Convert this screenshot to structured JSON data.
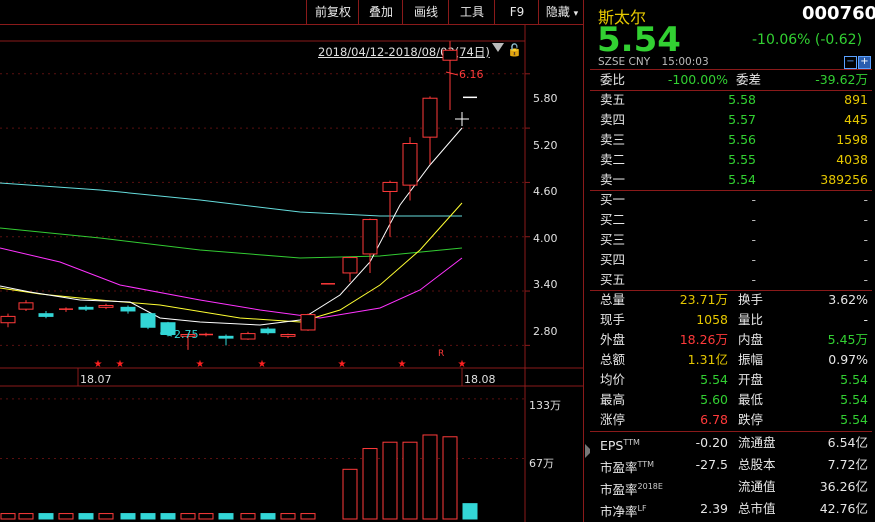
{
  "toolbar": {
    "buttons": [
      "前复权",
      "叠加",
      "画线",
      "工具",
      "F9",
      "隐藏"
    ]
  },
  "chart": {
    "date_range": "2018/04/12-2018/08/03(74日)",
    "price_axis": [
      "5.80",
      "5.20",
      "4.60",
      "4.00",
      "3.40",
      "2.80"
    ],
    "high_label": "6.16",
    "low_label": "2.75",
    "x_labels": [
      "18.07",
      "18.08"
    ],
    "r_marker": "R",
    "volume_axis": [
      "133万",
      "67万"
    ],
    "star": "★"
  },
  "chart_data": {
    "type": "candlestick",
    "candles": [
      {
        "o": 3.05,
        "c": 3.12,
        "h": 3.15,
        "l": 3.0
      },
      {
        "o": 3.2,
        "c": 3.27,
        "h": 3.3,
        "l": 3.18
      },
      {
        "o": 3.15,
        "c": 3.12,
        "h": 3.18,
        "l": 3.1
      },
      {
        "o": 3.2,
        "c": 3.2,
        "h": 3.22,
        "l": 3.17
      },
      {
        "o": 3.22,
        "c": 3.2,
        "h": 3.24,
        "l": 3.18
      },
      {
        "o": 3.22,
        "c": 3.24,
        "h": 3.26,
        "l": 3.2
      },
      {
        "o": 3.22,
        "c": 3.18,
        "h": 3.24,
        "l": 3.15
      },
      {
        "o": 3.15,
        "c": 3.0,
        "h": 3.16,
        "l": 2.98
      },
      {
        "o": 3.05,
        "c": 2.92,
        "h": 3.06,
        "l": 2.9
      },
      {
        "o": 2.9,
        "c": 2.92,
        "h": 2.93,
        "l": 2.75
      },
      {
        "o": 2.92,
        "c": 2.92,
        "h": 2.94,
        "l": 2.9
      },
      {
        "o": 2.9,
        "c": 2.88,
        "h": 2.92,
        "l": 2.8
      },
      {
        "o": 2.87,
        "c": 2.93,
        "h": 2.95,
        "l": 2.86
      },
      {
        "o": 2.98,
        "c": 2.94,
        "h": 3.0,
        "l": 2.92
      },
      {
        "o": 2.9,
        "c": 2.92,
        "h": 2.93,
        "l": 2.88
      },
      {
        "o": 2.97,
        "c": 3.14,
        "h": 3.15,
        "l": 2.96
      },
      {
        "o": 3.48,
        "c": 3.48,
        "h": 3.48,
        "l": 3.48
      },
      {
        "o": 3.6,
        "c": 3.77,
        "h": 3.78,
        "l": 3.5
      },
      {
        "o": 3.81,
        "c": 4.19,
        "h": 4.2,
        "l": 3.6
      },
      {
        "o": 4.5,
        "c": 4.6,
        "h": 4.62,
        "l": 4.0
      },
      {
        "o": 4.57,
        "c": 5.03,
        "h": 5.1,
        "l": 4.4
      },
      {
        "o": 5.1,
        "c": 5.53,
        "h": 5.55,
        "l": 4.8
      },
      {
        "o": 5.95,
        "c": 6.06,
        "h": 6.16,
        "l": 5.4
      },
      {
        "o": 5.54,
        "c": 5.54,
        "h": 5.54,
        "l": 5.54
      }
    ],
    "volume_wan": [
      6,
      6,
      6,
      6,
      6,
      6,
      6,
      6,
      6,
      6,
      6,
      6,
      6,
      6,
      6,
      6,
      0,
      55,
      78,
      85,
      85,
      93,
      91,
      17
    ],
    "ylim": [
      2.55,
      6.35
    ],
    "volume_ylim": [
      0,
      145
    ]
  },
  "quote": {
    "name": "斯太尔",
    "code": "000760",
    "price": "5.54",
    "change": "-10.06% (-0.62)",
    "exchange": "SZSE",
    "currency": "CNY",
    "time": "15:00:03"
  },
  "commission": {
    "ratio_label": "委比",
    "ratio": "-100.00%",
    "diff_label": "委差",
    "diff": "-39.62万"
  },
  "asks": [
    {
      "label": "卖五",
      "price": "5.58",
      "vol": "891"
    },
    {
      "label": "卖四",
      "price": "5.57",
      "vol": "445"
    },
    {
      "label": "卖三",
      "price": "5.56",
      "vol": "1598"
    },
    {
      "label": "卖二",
      "price": "5.55",
      "vol": "4038"
    },
    {
      "label": "卖一",
      "price": "5.54",
      "vol": "389256"
    }
  ],
  "bids": [
    {
      "label": "买一",
      "price": "-",
      "vol": "-"
    },
    {
      "label": "买二",
      "price": "-",
      "vol": "-"
    },
    {
      "label": "买三",
      "price": "-",
      "vol": "-"
    },
    {
      "label": "买四",
      "price": "-",
      "vol": "-"
    },
    {
      "label": "买五",
      "price": "-",
      "vol": "-"
    }
  ],
  "stats": [
    {
      "l1": "总量",
      "v1": "23.71万",
      "c1": "yellow",
      "l2": "换手",
      "v2": "3.62%",
      "c2": "white"
    },
    {
      "l1": "现手",
      "v1": "1058",
      "c1": "yellow",
      "l2": "量比",
      "v2": "-",
      "c2": "white"
    },
    {
      "l1": "外盘",
      "v1": "18.26万",
      "c1": "red",
      "l2": "内盘",
      "v2": "5.45万",
      "c2": "green"
    },
    {
      "l1": "总额",
      "v1": "1.31亿",
      "c1": "yellow",
      "l2": "振幅",
      "v2": "0.97%",
      "c2": "white"
    },
    {
      "l1": "均价",
      "v1": "5.54",
      "c1": "green",
      "l2": "开盘",
      "v2": "5.54",
      "c2": "green"
    },
    {
      "l1": "最高",
      "v1": "5.60",
      "c1": "green",
      "l2": "最低",
      "v2": "5.54",
      "c2": "green"
    },
    {
      "l1": "涨停",
      "v1": "6.78",
      "c1": "red",
      "l2": "跌停",
      "v2": "5.54",
      "c2": "green"
    }
  ],
  "fundamentals": [
    {
      "l1": "EPS",
      "sup1": "TTM",
      "v1": "-0.20",
      "l2": "流通盘",
      "v2": "6.54亿"
    },
    {
      "l1": "市盈率",
      "sup1": "TTM",
      "v1": "-27.5",
      "l2": "总股本",
      "v2": "7.72亿"
    },
    {
      "l1": "市盈率",
      "sup1": "2018E",
      "v1": "",
      "l2": "流通值",
      "v2": "36.26亿"
    },
    {
      "l1": "市净率",
      "sup1": "LF",
      "v1": "2.39",
      "l2": "总市值",
      "v2": "42.76亿"
    }
  ],
  "colors": {
    "up": "#ff3a3a",
    "down": "#33d6d6",
    "flat": "#ffffff",
    "ma5": "#ffffff",
    "ma10": "#ffff33",
    "ma20": "#ff33ff",
    "ma60": "#33cc33",
    "ma120": "#66dddd",
    "border": "#8a1a1a",
    "price_green": "#32d032"
  }
}
